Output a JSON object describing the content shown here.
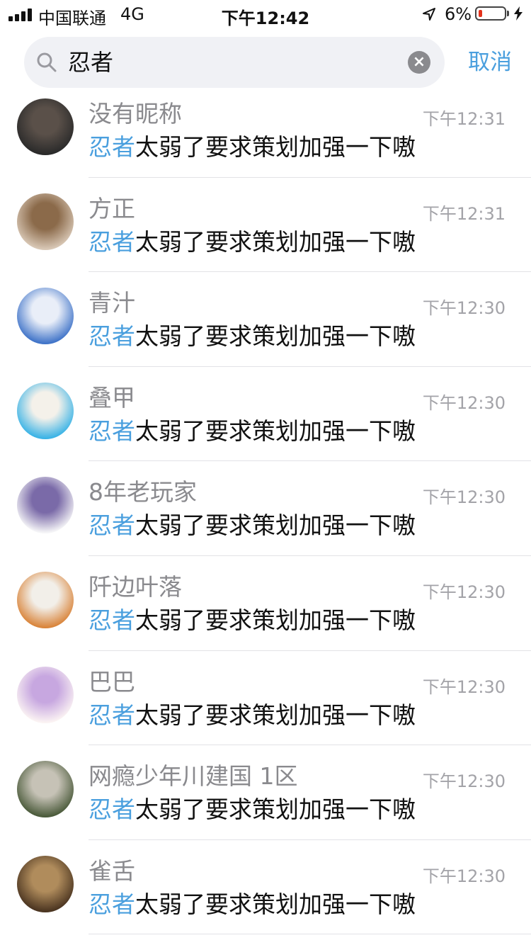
{
  "status_bar": {
    "carrier": "中国联通",
    "network": "4G",
    "time": "下午12:42",
    "battery": "6%",
    "battery_level": 0.06
  },
  "search": {
    "query": "忍者",
    "cancel_label": "取消"
  },
  "results": [
    {
      "name": "没有昵称",
      "time": "下午12:31",
      "keyword": "忍者",
      "text": "太弱了要求策划加强一下嗷",
      "avatar_colors": [
        "#2a2a2a",
        "#5a5049"
      ]
    },
    {
      "name": "方正",
      "time": "下午12:31",
      "keyword": "忍者",
      "text": "太弱了要求策划加强一下嗷",
      "avatar_colors": [
        "#d9c8b6",
        "#8b6a4a"
      ]
    },
    {
      "name": "青汁",
      "time": "下午12:30",
      "keyword": "忍者",
      "text": "太弱了要求策划加强一下嗷",
      "avatar_colors": [
        "#3f73c8",
        "#e9eef8"
      ]
    },
    {
      "name": "叠甲",
      "time": "下午12:30",
      "keyword": "忍者",
      "text": "太弱了要求策划加强一下嗷",
      "avatar_colors": [
        "#3ab3e6",
        "#f4f1ea"
      ]
    },
    {
      "name": "8年老玩家",
      "time": "下午12:30",
      "keyword": "忍者",
      "text": "太弱了要求策划加强一下嗷",
      "avatar_colors": [
        "#f5f5f7",
        "#7a6aa8"
      ]
    },
    {
      "name": "阡边叶落",
      "time": "下午12:30",
      "keyword": "忍者",
      "text": "太弱了要求策划加强一下嗷",
      "avatar_colors": [
        "#d9843a",
        "#f2efe9"
      ]
    },
    {
      "name": "巴巴",
      "time": "下午12:30",
      "keyword": "忍者",
      "text": "太弱了要求策划加强一下嗷",
      "avatar_colors": [
        "#fbf3f3",
        "#c7a7e0"
      ]
    },
    {
      "name": "网瘾少年川建国 1区",
      "time": "下午12:30",
      "keyword": "忍者",
      "text": "太弱了要求策划加强一下嗷",
      "avatar_colors": [
        "#4a5a3a",
        "#c6c2b6"
      ]
    },
    {
      "name": "雀舌",
      "time": "下午12:30",
      "keyword": "忍者",
      "text": "太弱了要求策划加强一下嗷",
      "avatar_colors": [
        "#4a3420",
        "#b08c5c"
      ]
    }
  ]
}
